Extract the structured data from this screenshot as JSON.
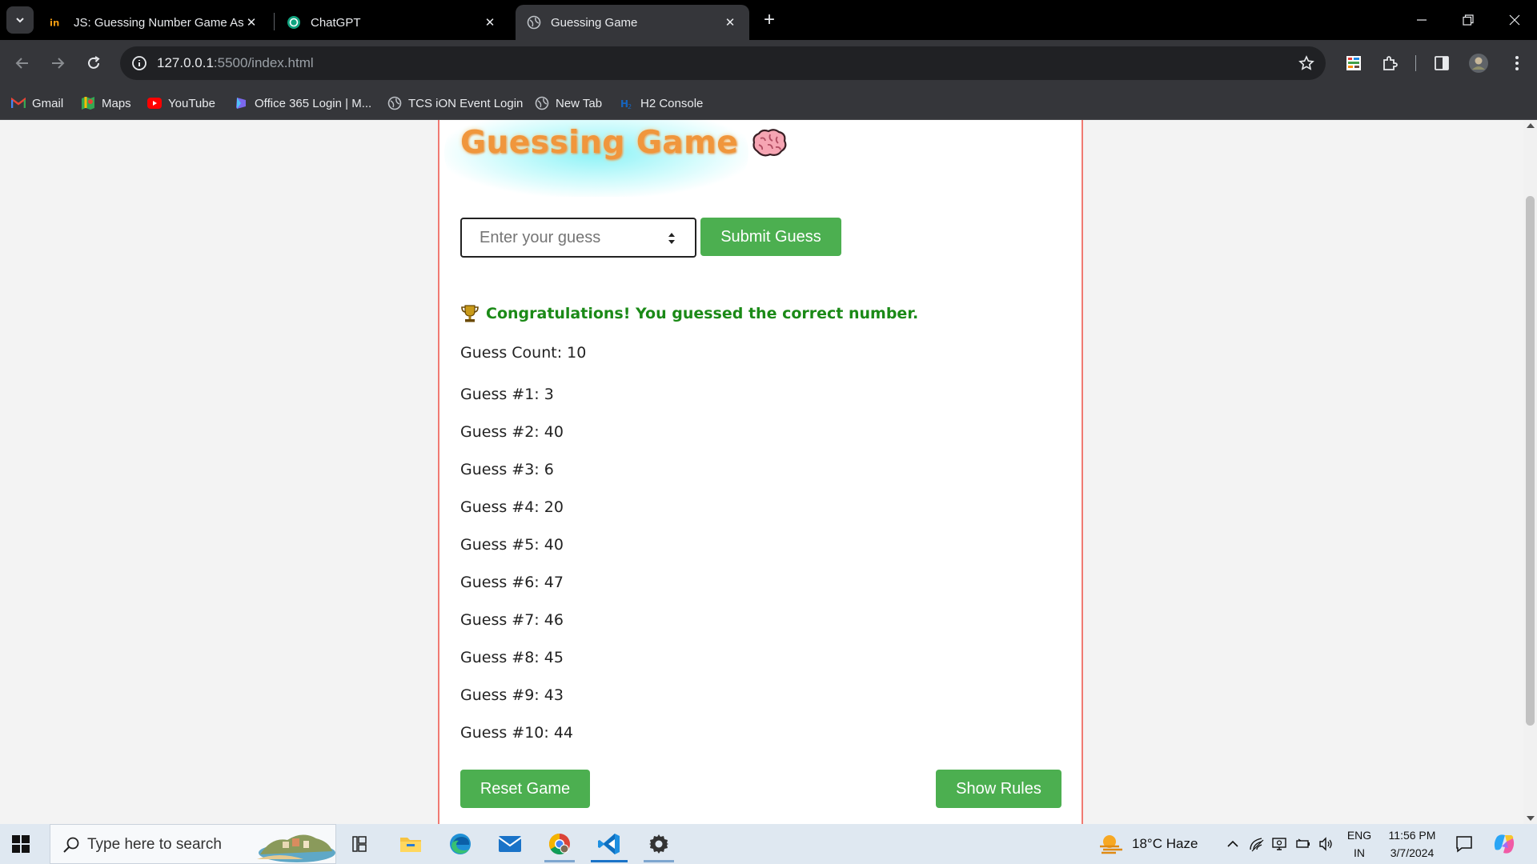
{
  "browser": {
    "tabs": [
      {
        "title": "JS: Guessing Number Game Ass",
        "favicon": "internshala-icon",
        "active": false
      },
      {
        "title": "ChatGPT",
        "favicon": "chatgpt-icon",
        "active": false
      },
      {
        "title": "Guessing Game",
        "favicon": "globe-icon",
        "active": true
      }
    ],
    "url_host": "127.0.0.1",
    "url_path": ":5500/index.html",
    "bookmarks": [
      {
        "label": "Gmail",
        "icon": "gmail-icon"
      },
      {
        "label": "Maps",
        "icon": "maps-icon"
      },
      {
        "label": "YouTube",
        "icon": "youtube-icon"
      },
      {
        "label": "Office 365 Login | M...",
        "icon": "office-icon"
      },
      {
        "label": "TCS iON Event Login",
        "icon": "globe-icon"
      },
      {
        "label": "New Tab",
        "icon": "globe-icon"
      },
      {
        "label": "H2 Console",
        "icon": "h2-icon"
      }
    ]
  },
  "game": {
    "title": "Guessing Game",
    "input_placeholder": "Enter your guess",
    "submit_label": "Submit Guess",
    "result_message": "Congratulations! You guessed the correct number.",
    "guess_count_text": "Guess Count: 10",
    "guesses": [
      "Guess #1: 3",
      "Guess #2: 40",
      "Guess #3: 6",
      "Guess #4: 20",
      "Guess #5: 40",
      "Guess #6: 47",
      "Guess #7: 46",
      "Guess #8: 45",
      "Guess #9: 43",
      "Guess #10: 44"
    ],
    "reset_label": "Reset Game",
    "rules_label": "Show Rules",
    "colors": {
      "button": "#4caf50",
      "success_text": "#1b8a17",
      "title": "#f0963c",
      "border": "#f07a72"
    }
  },
  "taskbar": {
    "search_placeholder": "Type here to search",
    "weather": "18°C  Haze",
    "lang_top": "ENG",
    "lang_bottom": "IN",
    "time": "11:56 PM",
    "date": "3/7/2024"
  }
}
